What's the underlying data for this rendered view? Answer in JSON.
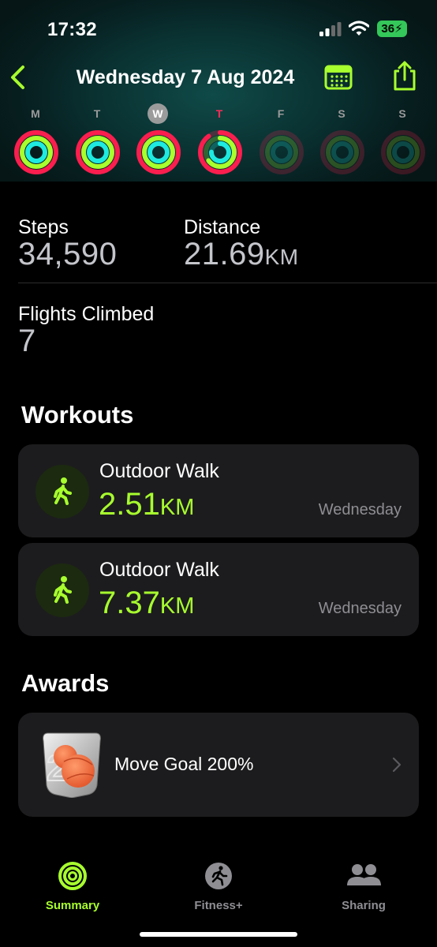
{
  "status_bar": {
    "time": "17:32",
    "battery": "36"
  },
  "nav": {
    "title": "Wednesday 7 Aug 2024"
  },
  "week": [
    {
      "label": "M",
      "move": 1.0,
      "exercise": 1.0,
      "stand": 1.0,
      "dim": false
    },
    {
      "label": "T",
      "move": 1.0,
      "exercise": 1.0,
      "stand": 1.0,
      "dim": false
    },
    {
      "label": "W",
      "move": 1.0,
      "exercise": 1.0,
      "stand": 1.0,
      "dim": false,
      "current": true
    },
    {
      "label": "T",
      "move": 0.9,
      "exercise": 0.65,
      "stand": 0.75,
      "dim": false,
      "today": true
    },
    {
      "label": "F",
      "move": 0,
      "exercise": 0,
      "stand": 0,
      "dim": true
    },
    {
      "label": "S",
      "move": 0,
      "exercise": 0,
      "stand": 0,
      "dim": true
    },
    {
      "label": "S",
      "move": 0,
      "exercise": 0,
      "stand": 0,
      "dim": true
    }
  ],
  "ring_colors": {
    "move": "#fa1e4e",
    "exercise": "#a8ff2e",
    "stand": "#1eeae0"
  },
  "stats": {
    "steps_label": "Steps",
    "steps_value": "34,590",
    "distance_label": "Distance",
    "distance_value": "21.69",
    "distance_unit": "KM",
    "flights_label": "Flights Climbed",
    "flights_value": "7"
  },
  "workouts": {
    "heading": "Workouts",
    "items": [
      {
        "name": "Outdoor Walk",
        "value": "2.51",
        "unit": "KM",
        "day": "Wednesday",
        "icon": "walking-figure-icon"
      },
      {
        "name": "Outdoor Walk",
        "value": "7.37",
        "unit": "KM",
        "day": "Wednesday",
        "icon": "walking-figure-icon"
      }
    ]
  },
  "awards": {
    "heading": "Awards",
    "items": [
      {
        "name": "Move Goal 200%",
        "icon": "move-goal-200-badge"
      }
    ]
  },
  "tabbar": {
    "items": [
      {
        "label": "Summary",
        "icon": "activity-rings-icon",
        "active": true
      },
      {
        "label": "Fitness+",
        "icon": "running-figure-icon",
        "active": false
      },
      {
        "label": "Sharing",
        "icon": "people-icon",
        "active": false
      }
    ]
  },
  "accent": "#a8ff2e"
}
